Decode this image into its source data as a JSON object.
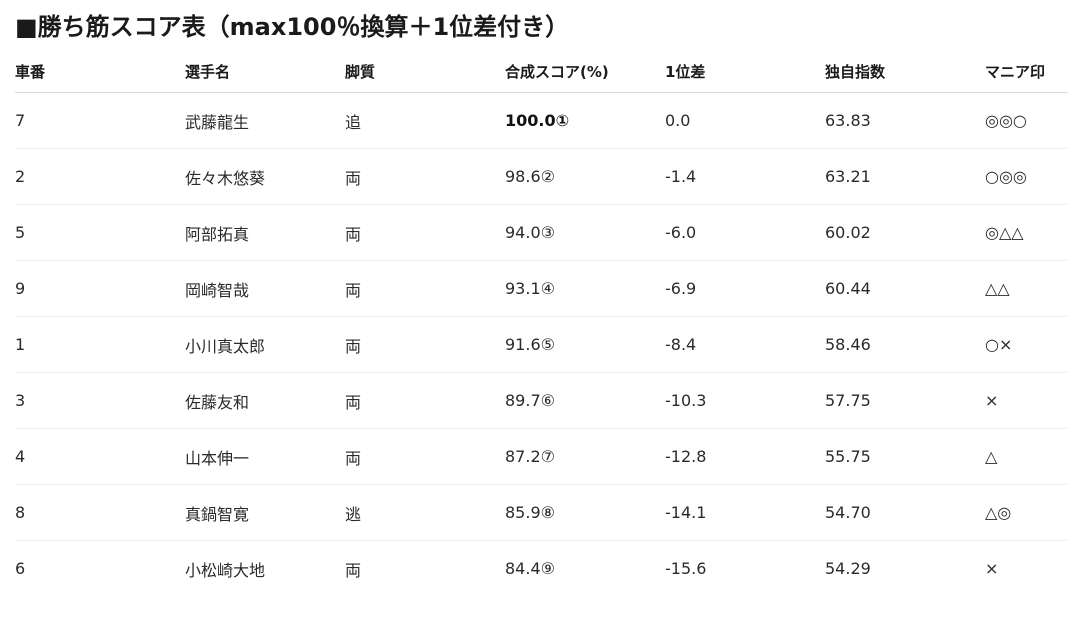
{
  "title": "■勝ち筋スコア表（max100％換算＋1位差付き）",
  "table": {
    "headers": [
      "車番",
      "選手名",
      "脚質",
      "合成スコア(%)",
      "1位差",
      "独自指数",
      "マニア印"
    ],
    "rows": [
      {
        "car": "7",
        "name": "武藤龍生",
        "style": "追",
        "score": "100.0①",
        "diff": "0.0",
        "index": "63.83",
        "mark": "◎◎○"
      },
      {
        "car": "2",
        "name": "佐々木悠葵",
        "style": "両",
        "score": "98.6②",
        "diff": "-1.4",
        "index": "63.21",
        "mark": "○◎◎"
      },
      {
        "car": "5",
        "name": "阿部拓真",
        "style": "両",
        "score": "94.0③",
        "diff": "-6.0",
        "index": "60.02",
        "mark": "◎△△"
      },
      {
        "car": "9",
        "name": "岡崎智哉",
        "style": "両",
        "score": "93.1④",
        "diff": "-6.9",
        "index": "60.44",
        "mark": "△△"
      },
      {
        "car": "1",
        "name": "小川真太郎",
        "style": "両",
        "score": "91.6⑤",
        "diff": "-8.4",
        "index": "58.46",
        "mark": "○×"
      },
      {
        "car": "3",
        "name": "佐藤友和",
        "style": "両",
        "score": "89.7⑥",
        "diff": "-10.3",
        "index": "57.75",
        "mark": "×"
      },
      {
        "car": "4",
        "name": "山本伸一",
        "style": "両",
        "score": "87.2⑦",
        "diff": "-12.8",
        "index": "55.75",
        "mark": "△"
      },
      {
        "car": "8",
        "name": "真鍋智寛",
        "style": "逃",
        "score": "85.9⑧",
        "diff": "-14.1",
        "index": "54.70",
        "mark": "△◎"
      },
      {
        "car": "6",
        "name": "小松崎大地",
        "style": "両",
        "score": "84.4⑨",
        "diff": "-15.6",
        "index": "54.29",
        "mark": "×"
      }
    ]
  }
}
